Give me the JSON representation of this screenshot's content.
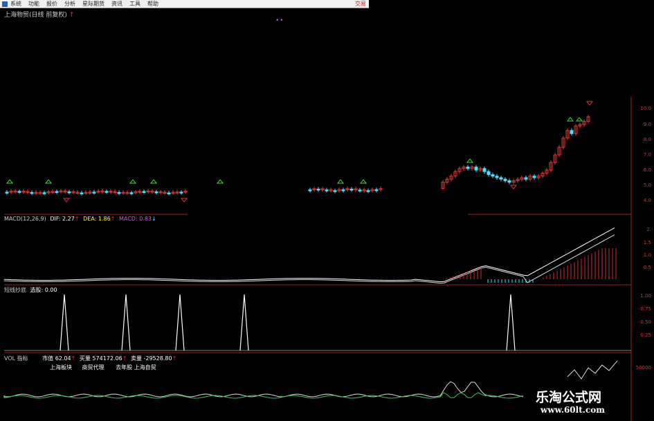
{
  "menu": {
    "items": [
      "系统",
      "功能",
      "报价",
      "分析",
      "星际期货",
      "资讯",
      "工具",
      "帮助"
    ],
    "right_tag": "交易"
  },
  "chart": {
    "title": "上海物贸(日线 前复权)",
    "title_arrow": "↑",
    "price_axis": [
      "10.0",
      "9.0",
      "8.0",
      "7.0",
      "6.0",
      "5.0",
      "4.0"
    ],
    "macd_label": {
      "name": "MACD(12,26,9)",
      "dif": "DIF: 2.27",
      "dea": "DEA: 1.86",
      "macd": "MACD: 0.83"
    },
    "macd_axis": [
      "2.",
      "1.5",
      "1.0",
      "0.5"
    ],
    "signal_label": {
      "name": "短线抄底",
      "value": "选股: 0.00"
    },
    "signal_axis": [
      "1.00",
      "0.75",
      "0.50",
      "0.25"
    ],
    "vol_label": {
      "name": "VOL 指标",
      "a": "市值 62.04",
      "b": "买量 574172.06",
      "c": "卖量 -29528.80"
    },
    "vol_tags": [
      "上海板块",
      "商贸代理",
      "去年股 上海自贸"
    ],
    "vol_axis": [
      "50000"
    ]
  },
  "colors": {
    "up": "#e03a3a",
    "down": "#4fe0ff",
    "line": "#ffffff",
    "macd_bar": "#d03030",
    "signal": "#ffffff",
    "axis": "#d33"
  },
  "watermark": {
    "line1": "乐淘公式网",
    "line2": "www.60lt.com"
  }
}
